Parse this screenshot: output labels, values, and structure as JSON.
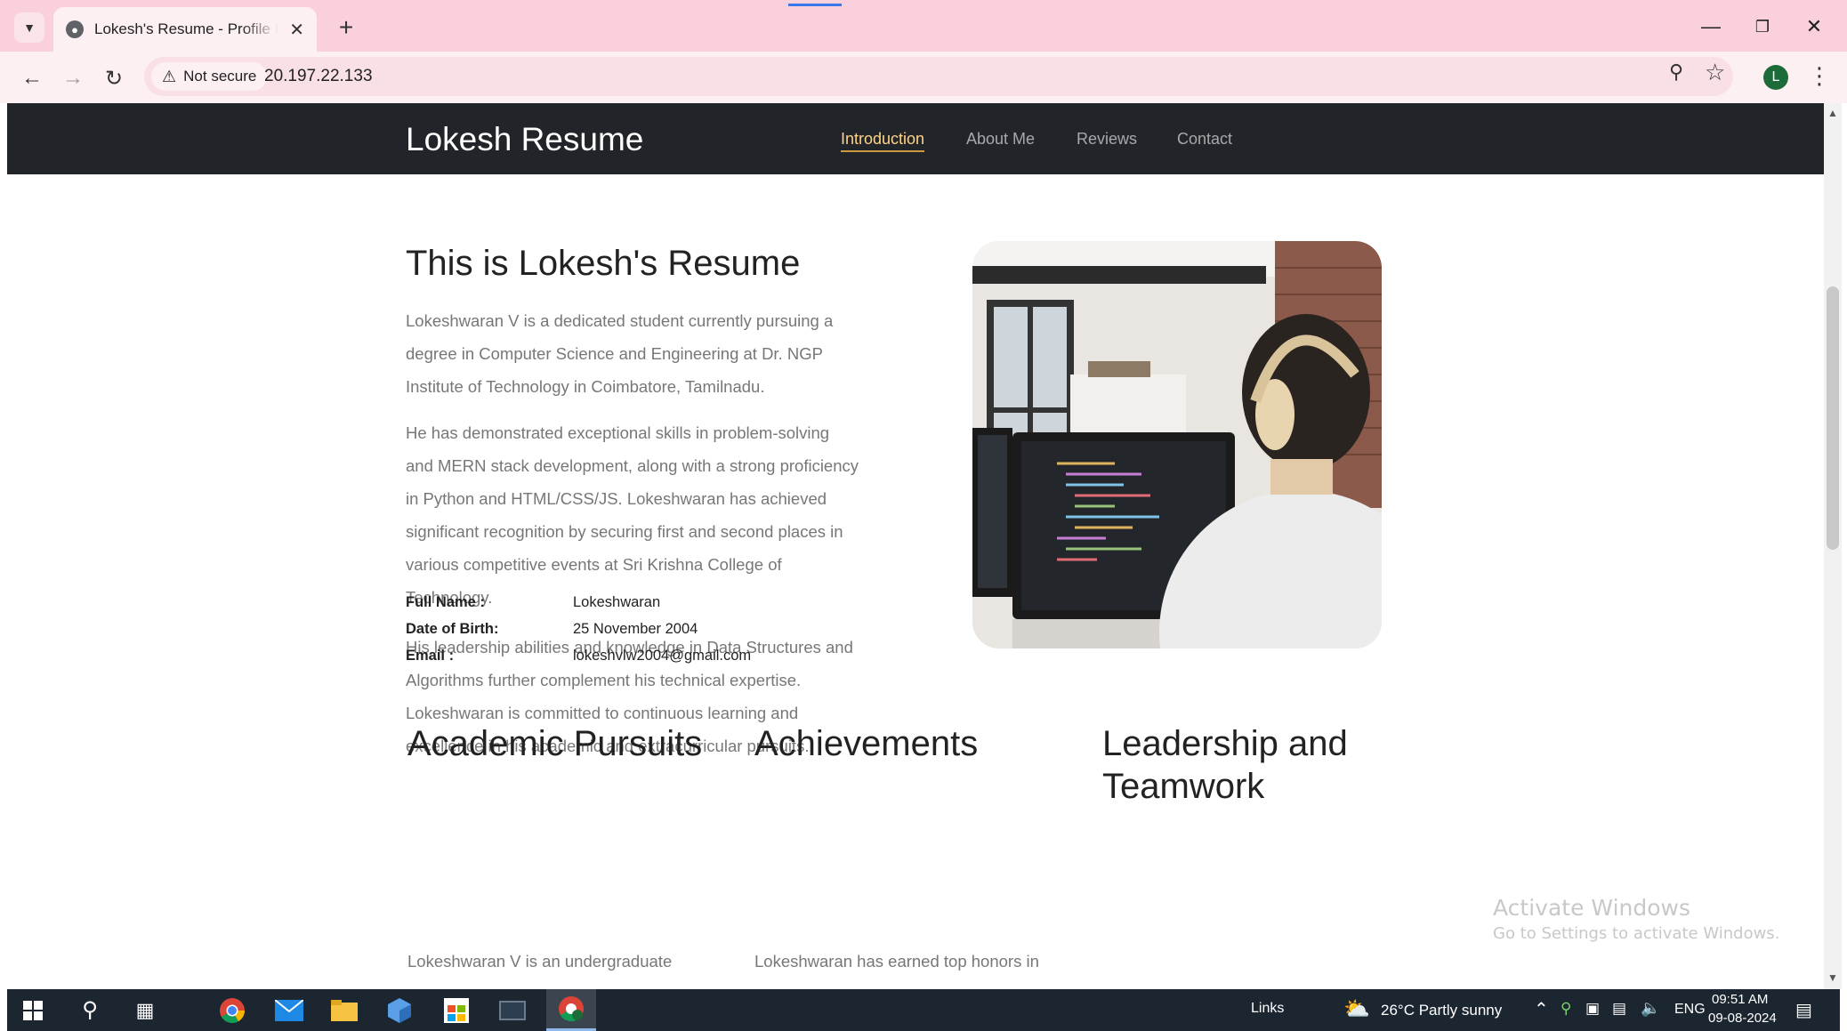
{
  "browser": {
    "tab_title": "Lokesh's Resume - Profile HTML",
    "tab_favicon": "globe-icon",
    "security_label": "Not secure",
    "url": "20.197.22.133",
    "profile_initial": "L"
  },
  "site": {
    "brand": "Lokesh Resume",
    "nav": [
      {
        "label": "Introduction",
        "active": true
      },
      {
        "label": "About Me",
        "active": false
      },
      {
        "label": "Reviews",
        "active": false
      },
      {
        "label": "Contact",
        "active": false
      }
    ],
    "intro": {
      "heading": "This is Lokesh's Resume",
      "paragraphs": [
        [
          "Lokeshwaran V is a dedicated student currently pursuing a",
          "degree in Computer Science and Engineering at Dr. NGP",
          "Institute of Technology in Coimbatore, Tamilnadu."
        ],
        [
          "He has demonstrated exceptional skills in problem-solving",
          "and MERN stack development, along with a strong proficiency",
          "in Python and HTML/CSS/JS. Lokeshwaran has achieved",
          "significant recognition by securing first and second places in",
          "various competitive events at Sri Krishna College of",
          "Technology."
        ],
        [
          "His leadership abilities and knowledge in Data Structures and",
          "Algorithms further complement his technical expertise.",
          "Lokeshwaran is committed to continuous learning and",
          "excellence in his academic and extracurricular pursuits."
        ]
      ]
    },
    "details": [
      {
        "label": "Full Name :",
        "value": "Lokeshwaran"
      },
      {
        "label": "Date of Birth:",
        "value": "25 November 2004"
      },
      {
        "label": "Email :",
        "value": "lokeshvlw2004@gmail.com"
      }
    ],
    "sections": [
      {
        "heading": [
          "Academic Pursuits"
        ],
        "text": "Lokeshwaran V is an undergraduate"
      },
      {
        "heading": [
          "Achievements"
        ],
        "text": "Lokeshwaran has earned top honors in"
      },
      {
        "heading": [
          "Leadership and",
          "Teamwork"
        ],
        "text": ""
      }
    ]
  },
  "watermark": {
    "title": "Activate Windows",
    "subtitle": "Go to Settings to activate Windows."
  },
  "taskbar": {
    "links_label": "Links",
    "weather": "26°C  Partly sunny",
    "language": "ENG",
    "time": "09:51 AM",
    "date": "09-08-2024"
  },
  "colors": {
    "tabbar": "#fad0dc",
    "toolbar": "#fdf0f3",
    "site_nav": "#212529",
    "nav_active": "#ffd38a",
    "taskbar": "#1c2630"
  }
}
